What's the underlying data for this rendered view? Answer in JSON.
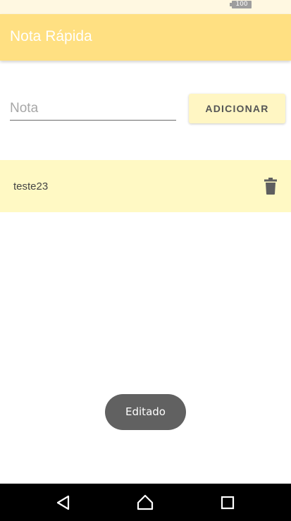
{
  "status_bar": {
    "battery_level": "100"
  },
  "app_bar": {
    "title": "Nota Rápida",
    "color": "#ffe082"
  },
  "form": {
    "note_input": {
      "placeholder": "Nota",
      "value": ""
    },
    "add_button_label": "ADICIONAR"
  },
  "notes": [
    {
      "text": "teste23",
      "action_icon": "trash-icon"
    }
  ],
  "toast": {
    "message": "Editado"
  },
  "navigation_bar": {
    "buttons": [
      "back-icon",
      "home-icon",
      "recents-icon"
    ]
  }
}
